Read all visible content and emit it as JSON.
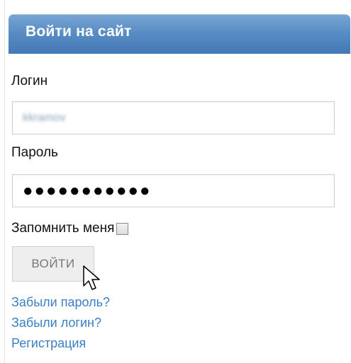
{
  "header": {
    "title": "Войти на сайт",
    "color": "#5a8dc5"
  },
  "form": {
    "login_label": "Логин",
    "login_value": "kkramov",
    "password_label": "Пароль",
    "password_value": "●●●●●●●●●●●",
    "remember_label": "Запомнить меня",
    "remember_checked": false,
    "submit_label": "ВОЙТИ"
  },
  "links": {
    "forgot_password": "Забыли пароль?",
    "forgot_login": "Забыли логин?",
    "register": "Регистрация",
    "color": "#3b7fc2"
  },
  "cursor": {
    "icon": "arrow-cursor-icon"
  }
}
